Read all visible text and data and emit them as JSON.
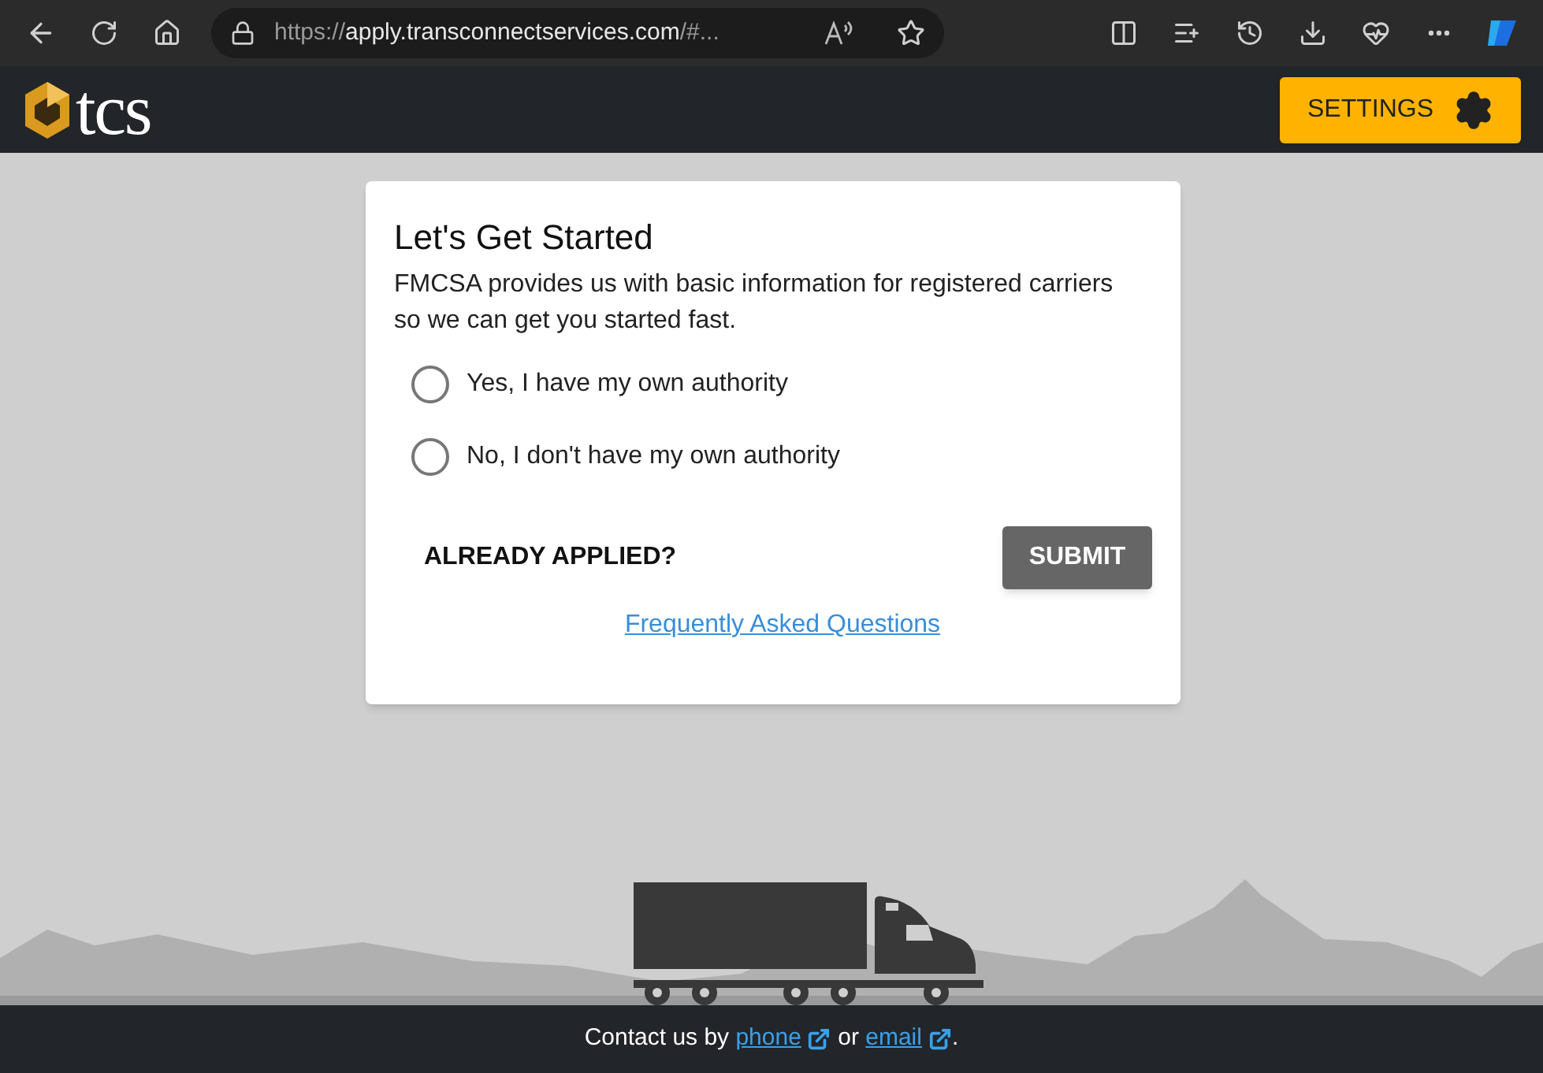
{
  "browser": {
    "url_prefix": "https://",
    "url_host": "apply.transconnectservices.com",
    "url_rest": "/#..."
  },
  "header": {
    "logo": "tcs",
    "settings": "SETTINGS"
  },
  "card": {
    "title": "Let's Get Started",
    "description": "FMCSA provides us with basic information for registered carriers so we can get you started fast.",
    "options": [
      {
        "label": "Yes, I have my own authority",
        "selected": false
      },
      {
        "label": "No, I don't have my own authority",
        "selected": false
      }
    ],
    "already_applied": "ALREADY APPLIED?",
    "submit": "SUBMIT",
    "faq": "Frequently Asked Questions"
  },
  "footer": {
    "before": "Contact us by",
    "phone": "phone",
    "middle": "or",
    "email": "email",
    "end": "."
  }
}
